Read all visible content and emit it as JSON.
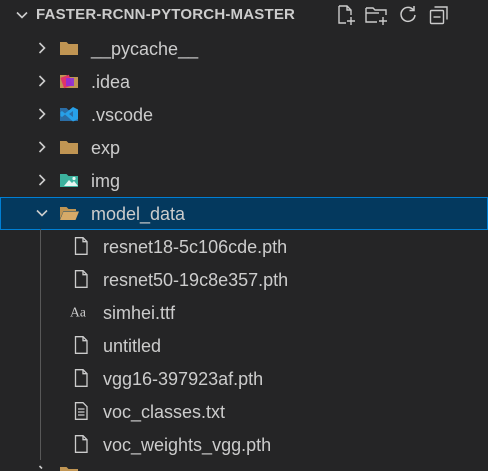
{
  "header": {
    "title": "FASTER-RCNN-PYTORCH-MASTER",
    "actions": [
      {
        "name": "new-file",
        "icon": "new-file-icon"
      },
      {
        "name": "new-folder",
        "icon": "new-folder-icon"
      },
      {
        "name": "refresh",
        "icon": "refresh-icon"
      },
      {
        "name": "collapse-all",
        "icon": "collapse-all-icon"
      }
    ]
  },
  "tree": {
    "items": [
      {
        "label": "__pycache__",
        "type": "folder",
        "expanded": false,
        "icon": "folder-icon",
        "color": "#c09553"
      },
      {
        "label": ".idea",
        "type": "folder",
        "expanded": false,
        "icon": "idea-folder-icon",
        "color": "#c09553"
      },
      {
        "label": ".vscode",
        "type": "folder",
        "expanded": false,
        "icon": "vscode-folder-icon",
        "color": "#1e8ad6"
      },
      {
        "label": "exp",
        "type": "folder",
        "expanded": false,
        "icon": "folder-icon",
        "color": "#c09553"
      },
      {
        "label": "img",
        "type": "folder",
        "expanded": false,
        "icon": "image-folder-icon",
        "color": "#3cb29e"
      },
      {
        "label": "model_data",
        "type": "folder",
        "expanded": true,
        "selected": true,
        "icon": "folder-open-icon",
        "color": "#c09553"
      },
      {
        "label": "resnet18-5c106cde.pth",
        "type": "file",
        "icon": "file-icon"
      },
      {
        "label": "resnet50-19c8e357.pth",
        "type": "file",
        "icon": "file-icon"
      },
      {
        "label": "simhei.ttf",
        "type": "file",
        "icon": "font-icon"
      },
      {
        "label": "untitled",
        "type": "file",
        "icon": "file-icon"
      },
      {
        "label": "vgg16-397923af.pth",
        "type": "file",
        "icon": "file-icon"
      },
      {
        "label": "voc_classes.txt",
        "type": "file",
        "icon": "text-file-icon"
      },
      {
        "label": "voc_weights_vgg.pth",
        "type": "file",
        "icon": "file-icon"
      }
    ]
  },
  "colors": {
    "background": "#252526",
    "selection": "#04395e",
    "selection_border": "#007fd4",
    "text": "#cccccc"
  }
}
